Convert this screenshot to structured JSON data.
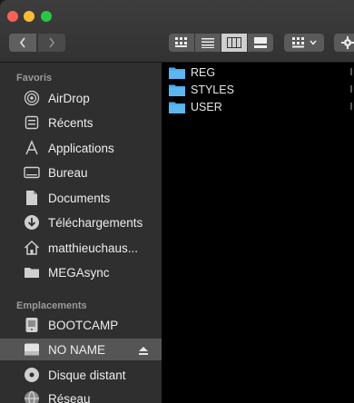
{
  "sidebar": {
    "favorites_title": "Favoris",
    "favorites": [
      {
        "label": "AirDrop",
        "icon": "airdrop-icon"
      },
      {
        "label": "Récents",
        "icon": "recents-icon"
      },
      {
        "label": "Applications",
        "icon": "applications-icon"
      },
      {
        "label": "Bureau",
        "icon": "desktop-icon"
      },
      {
        "label": "Documents",
        "icon": "documents-icon"
      },
      {
        "label": "Téléchargements",
        "icon": "downloads-icon"
      },
      {
        "label": "matthieuchaus...",
        "icon": "home-icon"
      },
      {
        "label": "MEGAsync",
        "icon": "folder-icon"
      }
    ],
    "locations_title": "Emplacements",
    "locations": [
      {
        "label": "BOOTCAMP",
        "icon": "drive-icon"
      },
      {
        "label": "NO NAME",
        "icon": "drive-icon",
        "selected": true
      },
      {
        "label": "Disque distant",
        "icon": "disc-icon"
      },
      {
        "label": "Réseau",
        "icon": "network-icon"
      }
    ]
  },
  "content": {
    "files": [
      "REG",
      "STYLES",
      "USER"
    ]
  },
  "colors": {
    "folder": "#4aa9ea",
    "sidebar_bg": "#2f2f2f",
    "selected_bg": "#555555"
  }
}
